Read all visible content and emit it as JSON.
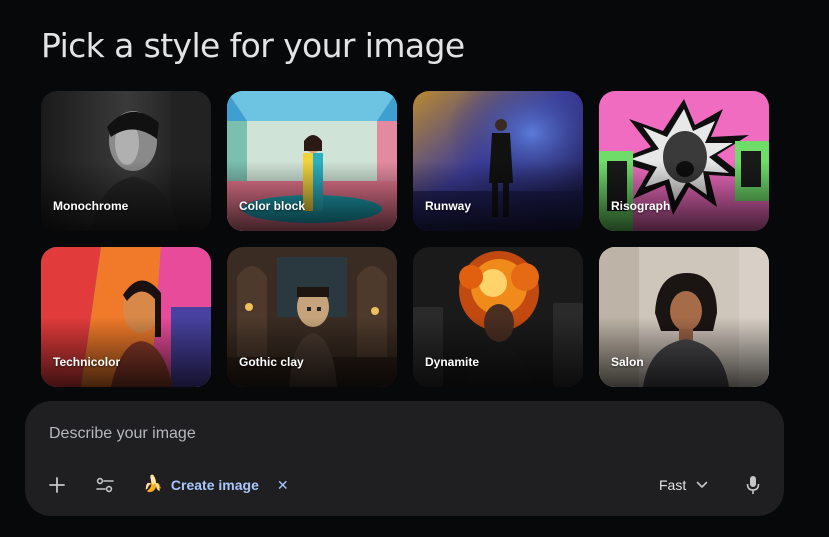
{
  "page": {
    "title": "Pick a style for your image"
  },
  "styles": [
    {
      "label": "Monochrome"
    },
    {
      "label": "Color block"
    },
    {
      "label": "Runway"
    },
    {
      "label": "Risograph"
    },
    {
      "label": "Technicolor"
    },
    {
      "label": "Gothic clay"
    },
    {
      "label": "Dynamite"
    },
    {
      "label": "Salon"
    }
  ],
  "prompt": {
    "placeholder": "Describe your image",
    "value": "",
    "tools_icons": {
      "add": "plus-icon",
      "tools": "sliders-icon",
      "mic": "mic-icon"
    },
    "chip": {
      "icon": "banana-icon",
      "emoji": "🍌",
      "label": "Create image",
      "close": "✕"
    },
    "mode": {
      "label": "Fast",
      "icon": "chevron-down-icon"
    }
  },
  "colors": {
    "background": "#07080a",
    "panel": "#1f1f21",
    "accent": "#a8c7fa",
    "text": "#e3e3e3"
  }
}
